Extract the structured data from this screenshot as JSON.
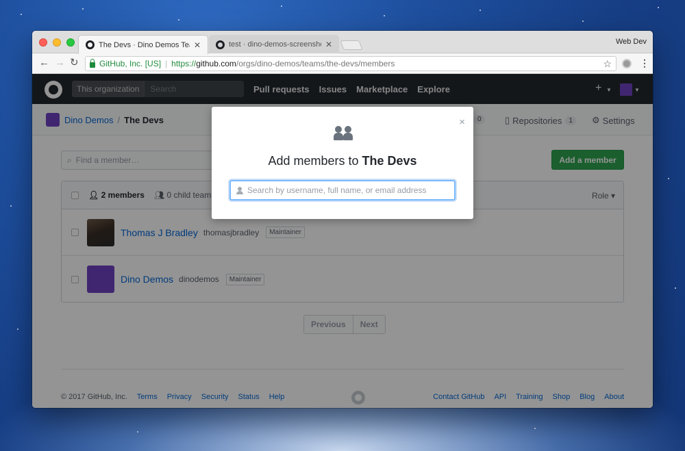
{
  "browser": {
    "tabs": [
      {
        "title": "The Devs · Dino Demos Team"
      },
      {
        "title": "test · dino-demos-screenshot-"
      }
    ],
    "profile": "Web Dev",
    "security_label": "GitHub, Inc. [US]",
    "url_protocol": "https://",
    "url_host": "github.com",
    "url_path": "/orgs/dino-demos/teams/the-devs/members"
  },
  "header": {
    "scope_label": "This organization",
    "search_placeholder": "Search",
    "nav": [
      "Pull requests",
      "Issues",
      "Marketplace",
      "Explore"
    ]
  },
  "subhead": {
    "org": "Dino Demos",
    "team": "The Devs",
    "members_count": "0",
    "repositories_label": "Repositories",
    "repositories_count": "1",
    "settings_label": "Settings"
  },
  "members_page": {
    "find_placeholder": "Find a member…",
    "add_button": "Add a member",
    "count_label": "2 members",
    "child_teams_label": "0 child team",
    "role_label": "Role",
    "members": [
      {
        "name": "Thomas J Bradley",
        "login": "thomasjbradley",
        "role": "Maintainer"
      },
      {
        "name": "Dino Demos",
        "login": "dinodemos",
        "role": "Maintainer"
      }
    ],
    "prev": "Previous",
    "next": "Next"
  },
  "footer": {
    "copyright": "© 2017 GitHub, Inc.",
    "left_links": [
      "Terms",
      "Privacy",
      "Security",
      "Status",
      "Help"
    ],
    "right_links": [
      "Contact GitHub",
      "API",
      "Training",
      "Shop",
      "Blog",
      "About"
    ]
  },
  "modal": {
    "title_prefix": "Add members to ",
    "team_name": "The Devs",
    "search_placeholder": "Search by username, full name, or email address",
    "close_glyph": "×"
  }
}
